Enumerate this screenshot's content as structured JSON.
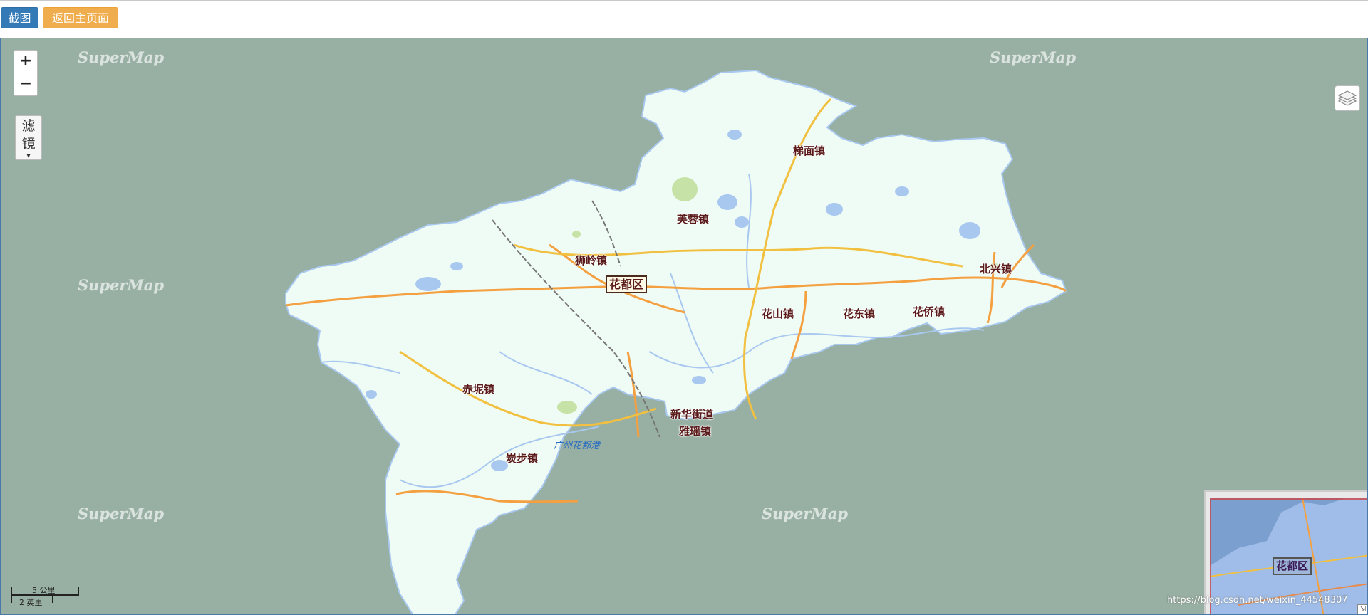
{
  "toolbar": {
    "screenshot_button": "截图",
    "home_button": "返回主页面"
  },
  "map": {
    "watermark": "SuperMap",
    "district_label": "花都区",
    "places": {
      "timian": "梯面镇",
      "furong": "芙蓉镇",
      "shiling": "狮岭镇",
      "beixing": "北兴镇",
      "huashan": "花山镇",
      "huadong": "花东镇",
      "huaqiao": "花侨镇",
      "chini": "赤坭镇",
      "xinhua": "新华街道",
      "xiuquan": "雅瑶镇",
      "tanbu": "炭步镇"
    },
    "water_label": "广州花都港",
    "colors": {
      "background": "#98b0a3",
      "land": "#effcf5",
      "water": "#a8c8f0",
      "major_road": "#f4a040",
      "highway": "#f2c040"
    }
  },
  "controls": {
    "zoom_in": "+",
    "zoom_out": "−",
    "filter_label": "滤镜",
    "filter_caret": "▾"
  },
  "scale": {
    "metric": "5 公里",
    "imperial": "2 英里"
  },
  "overview": {
    "label": "花都区",
    "toggle": "⇲"
  },
  "credit": "https://blog.csdn.net/weixin_44548307"
}
